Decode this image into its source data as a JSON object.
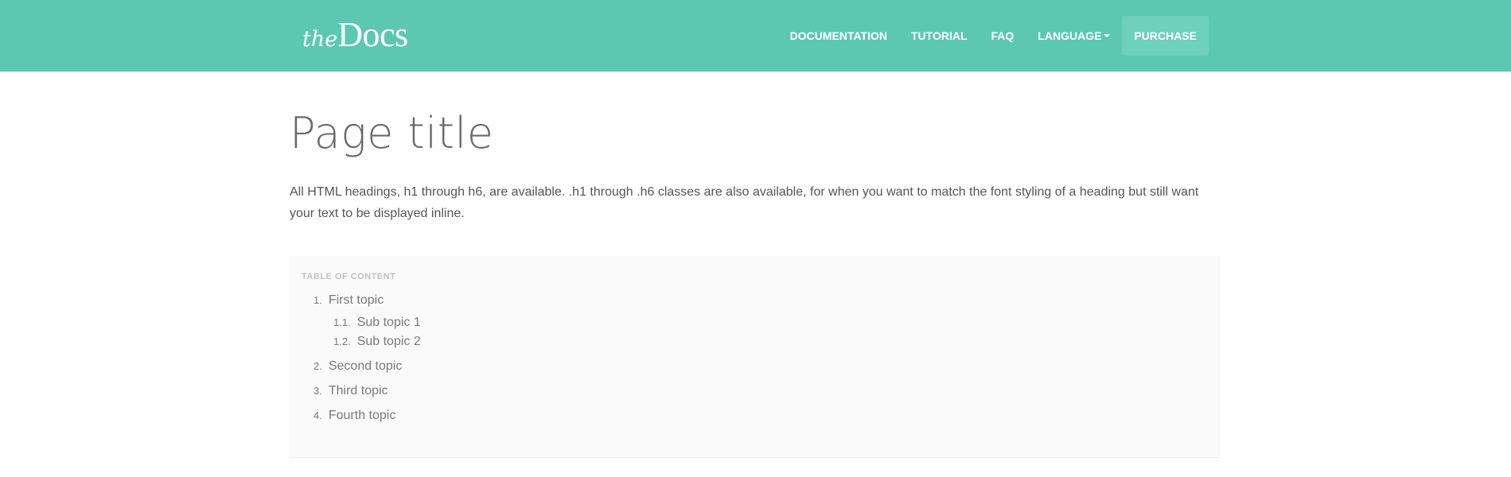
{
  "brand": {
    "logo_prefix": "the",
    "logo_main": "Docs",
    "color": "#5cc8b2"
  },
  "nav": {
    "items": [
      {
        "label": "DOCUMENTATION"
      },
      {
        "label": "TUTORIAL"
      },
      {
        "label": "FAQ"
      },
      {
        "label": "LANGUAGE",
        "has_dropdown": true
      },
      {
        "label": "PURCHASE",
        "active": true
      }
    ]
  },
  "main": {
    "page_title": "Page title",
    "lead": "All HTML headings, h1 through h6, are available. .h1 through .h6 classes are also available, for when you want to match the font styling of a heading but still want your text to be displayed inline."
  },
  "toc": {
    "heading": "TABLE OF CONTENT",
    "items": [
      {
        "num": "1.",
        "label": "First topic",
        "children": [
          {
            "num": "1.1.",
            "label": "Sub topic 1"
          },
          {
            "num": "1.2.",
            "label": "Sub topic 2"
          }
        ]
      },
      {
        "num": "2.",
        "label": "Second topic"
      },
      {
        "num": "3.",
        "label": "Third topic"
      },
      {
        "num": "4.",
        "label": "Fourth topic"
      }
    ]
  }
}
